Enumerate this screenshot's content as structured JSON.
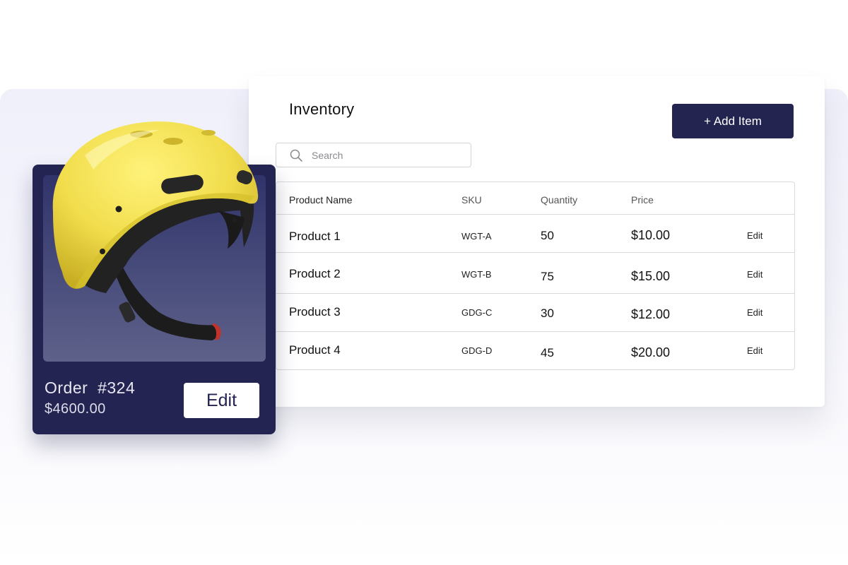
{
  "inventory": {
    "title": "Inventory",
    "add_button_label": "+ Add Item",
    "search": {
      "placeholder": "Search",
      "value": ""
    },
    "columns": [
      "Product Name",
      "SKU",
      "Quantity",
      "Price"
    ],
    "rows": [
      {
        "name": "Product 1",
        "sku": "WGT-A",
        "quantity": "50",
        "price": "$10.00",
        "action": "Edit"
      },
      {
        "name": "Product 2",
        "sku": "WGT-B",
        "quantity": "75",
        "price": "$15.00",
        "action": "Edit"
      },
      {
        "name": "Product 3",
        "sku": "GDG-C",
        "quantity": "30",
        "price": "$12.00",
        "action": "Edit"
      },
      {
        "name": "Product 4",
        "sku": "GDG-D",
        "quantity": "45",
        "price": "$20.00",
        "action": "Edit"
      }
    ]
  },
  "order_card": {
    "title": "Order  #324",
    "total": "$4600.00",
    "edit_label": "Edit",
    "image": "yellow-helmet"
  },
  "colors": {
    "navy": "#232451",
    "helmet_yellow": "#f3e15a"
  }
}
